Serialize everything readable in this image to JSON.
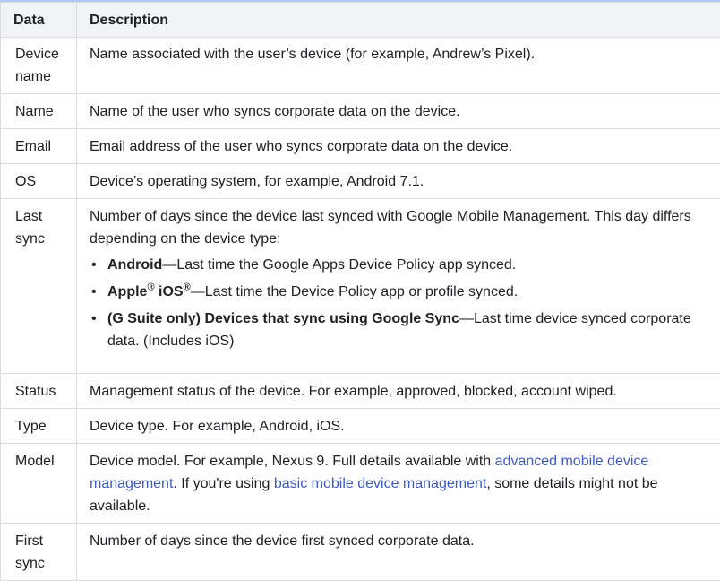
{
  "headers": {
    "data": "Data",
    "description": "Description"
  },
  "rows": {
    "device_name": {
      "label": "Device name",
      "description": "Name associated with the user’s device (for example, Andrew’s Pixel)."
    },
    "name": {
      "label": "Name",
      "description": "Name of the user who syncs corporate data on the device."
    },
    "email": {
      "label": "Email",
      "description": "Email address of the user who syncs corporate data on the device."
    },
    "os": {
      "label": "OS",
      "description": "Device’s operating system, for example, Android 7.1."
    },
    "last_sync": {
      "label": "Last sync",
      "intro": "Number of days since the device last synced with Google Mobile Management. This day differs depending on the device type:",
      "bullets": {
        "android": {
          "bold": "Android",
          "text": "—Last time the Google Apps Device Policy app synced."
        },
        "apple": {
          "bold_apple": "Apple",
          "reg1": "®",
          "bold_ios": " iOS",
          "reg2": "®",
          "text": "—Last time the Device Policy app or profile synced."
        },
        "gsuite": {
          "bold": "(G Suite only) Devices that sync using Google Sync",
          "text": "—Last time device synced corporate data. (Includes iOS)"
        }
      }
    },
    "status": {
      "label": "Status",
      "description": "Management status of the device. For example, approved, blocked, account wiped."
    },
    "type": {
      "label": "Type",
      "description": "Device type. For example, Android, iOS."
    },
    "model": {
      "label": "Model",
      "text1": "Device model. For example, Nexus 9. Full details available with ",
      "link1": "advanced mobile device management",
      "text2": ". If you're using ",
      "link2": "basic mobile device management",
      "text3": ", some details might not be available."
    },
    "first_sync": {
      "label": "First sync",
      "description": "Number of days since the device first synced corporate data."
    }
  }
}
